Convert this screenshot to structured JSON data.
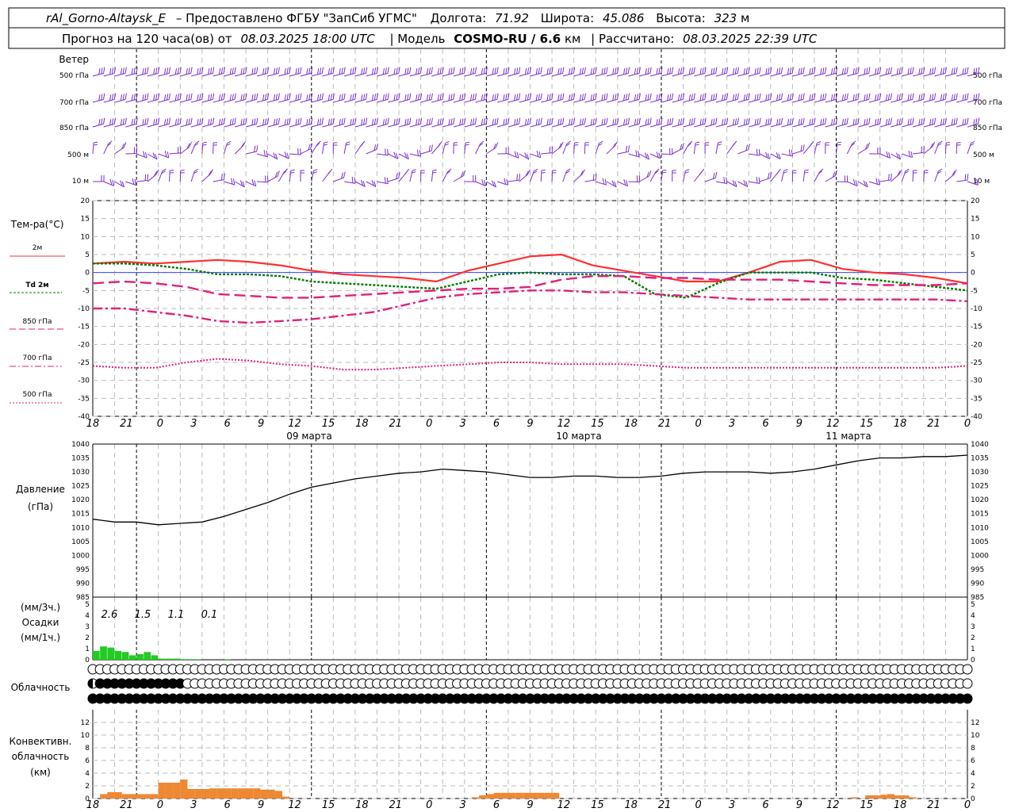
{
  "header": {
    "station": "rAl_Gorno-Altaysk_E",
    "provider": "– Предоставлено ФГБУ \"ЗапСиб УГМС\"",
    "lon_label": "Долгота:",
    "lon": "71.92",
    "lat_label": "Широта:",
    "lat": "45.086",
    "alt_label": "Высота:",
    "alt": "323",
    "alt_unit": "м",
    "fc_label": "Прогноз на 120 часа(ов)  от",
    "fc_time": "08.03.2025 18:00 UTC",
    "model_label": "| Модель",
    "model": "COSMO-RU / 6.6",
    "model_unit": "км",
    "calc_label": "| Рассчитано:",
    "calc_time": "08.03.2025 22:39 UTC"
  },
  "labels": {
    "wind": "Ветер",
    "wind_levels": [
      "500 гПа",
      "700 гПа",
      "850 гПа",
      "500 м",
      "10  м"
    ],
    "temp_title": "Тем-ра(°С)",
    "legend": [
      "2м",
      "Td  2м",
      "850 гПа",
      "700 гПа",
      "500 гПа"
    ],
    "pressure": "Давление",
    "pressure_unit": "(гПа)",
    "precip_unit3": "(мм/3ч.)",
    "precip": "Осадки",
    "precip_unit1": "(мм/1ч.)",
    "cloud": "Облачность",
    "conv": [
      "Конвективн.",
      "облачность",
      "(км)"
    ],
    "days": [
      "09 марта",
      "10 марта",
      "11 марта"
    ]
  },
  "time_ticks": [
    "18",
    "21",
    "0",
    "3",
    "6",
    "9",
    "12",
    "15",
    "18",
    "21",
    "0",
    "3",
    "6",
    "9",
    "12",
    "15",
    "18",
    "21",
    "0",
    "3",
    "6",
    "9",
    "12",
    "15",
    "18",
    "21",
    "0"
  ],
  "colors": {
    "wind": "#7b2fd0",
    "t2m": "#ff3030",
    "td2m": "#007a00",
    "t850": "#e0207a",
    "t700": "#e0207a",
    "t500": "#e0207a",
    "pressure": "#000000",
    "precip": "#22cc22",
    "conv": "#ee8833",
    "grid": "#bbbbbb",
    "zero": "#3344ff"
  },
  "chart_data": [
    {
      "type": "line",
      "name": "temperature",
      "ylabel": "Тем-ра(°С)",
      "ylim": [
        -40,
        20
      ],
      "yticks": [
        20,
        15,
        10,
        5,
        0,
        -5,
        -10,
        -15,
        -20,
        -25,
        -30,
        -35,
        -40
      ],
      "x_hours": [
        0,
        3,
        6,
        9,
        12,
        15,
        18,
        21,
        24,
        27,
        30,
        33,
        36,
        39,
        42,
        45,
        48,
        51,
        54,
        57,
        60,
        63,
        66,
        69,
        72,
        75,
        78
      ],
      "series": [
        {
          "name": "2м",
          "style": "solid",
          "values": [
            2.5,
            3,
            2.5,
            3,
            3.5,
            3,
            2,
            0.5,
            -0.5,
            -1,
            -1.5,
            -2.5,
            0.5,
            2.5,
            4.5,
            5,
            2,
            0.5,
            -1,
            -2.5,
            -2.5,
            0,
            3,
            3.5,
            1,
            0,
            -0.5,
            -1.5,
            -3
          ]
        },
        {
          "name": "Td  2м",
          "style": "dotted",
          "values": [
            2.5,
            2.5,
            2,
            1,
            -0.5,
            -0.5,
            -1,
            -2.5,
            -3,
            -3.5,
            -4,
            -4.5,
            -2.5,
            -0.5,
            0,
            -0.5,
            -0.5,
            -1,
            -6,
            -7,
            -3,
            0,
            0,
            0,
            -1.5,
            -2,
            -3,
            -4,
            -5
          ]
        },
        {
          "name": "850 гПа",
          "style": "dashed",
          "values": [
            -3,
            -2.5,
            -3,
            -4,
            -6,
            -6.5,
            -7,
            -7,
            -6.5,
            -6,
            -5.5,
            -5,
            -4.5,
            -4.5,
            -4,
            -2,
            -1,
            -1,
            -1.5,
            -1.5,
            -2,
            -2,
            -2,
            -2.5,
            -3,
            -3.5,
            -3.5,
            -3.5,
            -3
          ]
        },
        {
          "name": "700 гПа",
          "style": "dashdot",
          "values": [
            -10,
            -10,
            -11,
            -12,
            -13.5,
            -14,
            -13.5,
            -13,
            -12,
            -11,
            -9,
            -7,
            -6,
            -5.5,
            -5,
            -5,
            -5.5,
            -5.5,
            -6,
            -6.5,
            -7,
            -7.5,
            -7.5,
            -7.5,
            -7.5,
            -7.5,
            -7.5,
            -7.5,
            -8
          ]
        },
        {
          "name": "500 гПа",
          "style": "dotted",
          "values": [
            -26,
            -26.5,
            -26.5,
            -25,
            -24,
            -24.5,
            -25.5,
            -26,
            -27,
            -27,
            -26.5,
            -26,
            -25.5,
            -25,
            -25,
            -25.5,
            -25.5,
            -25.5,
            -26,
            -26.5,
            -26.5,
            -26.5,
            -26.5,
            -26.5,
            -26.5,
            -26.5,
            -26.5,
            -26.5,
            -26
          ]
        }
      ]
    },
    {
      "type": "line",
      "name": "pressure",
      "ylabel": "Давление (гПа)",
      "ylim": [
        985,
        1040
      ],
      "yticks": [
        1040,
        1035,
        1030,
        1025,
        1020,
        1015,
        1010,
        1005,
        1000,
        995,
        990,
        985
      ],
      "x_hours": [
        0,
        3,
        6,
        9,
        12,
        15,
        18,
        21,
        24,
        27,
        30,
        33,
        36,
        39,
        42,
        45,
        48,
        51,
        54,
        57,
        60,
        63,
        66,
        69,
        72,
        75,
        78,
        81,
        84,
        87,
        90,
        93,
        96,
        99,
        102,
        105,
        108,
        111,
        114,
        117,
        120
      ],
      "series": [
        {
          "name": "Давление",
          "values": [
            1013,
            1012,
            1012,
            1011,
            1011.5,
            1012,
            1014,
            1016.5,
            1019,
            1022,
            1024.5,
            1026,
            1027.5,
            1028.5,
            1029.5,
            1030,
            1031,
            1030.5,
            1030,
            1029,
            1028,
            1028,
            1028.5,
            1028.5,
            1028,
            1028,
            1028.5,
            1029.5,
            1030,
            1030,
            1030,
            1029.5,
            1030,
            1031,
            1032.5,
            1034,
            1035,
            1035,
            1035.5,
            1035.5,
            1036
          ]
        }
      ]
    },
    {
      "type": "bar",
      "name": "precipitation",
      "ylabel": "Осадки",
      "ylim": [
        0,
        5
      ],
      "yticks": [
        5,
        4,
        3,
        2,
        1,
        0
      ],
      "totals_3h": [
        "2.6",
        "1.5",
        "1.1",
        "0.1"
      ],
      "x_hours": [
        0,
        1,
        2,
        3,
        4,
        5,
        6,
        7,
        8,
        9,
        10,
        11,
        12,
        13,
        14,
        15,
        16,
        17,
        18
      ],
      "values": [
        0.8,
        1.2,
        1.1,
        0.8,
        0.7,
        0.4,
        0.5,
        0.7,
        0.4,
        0.1,
        0.1,
        0.1,
        0.05,
        0.05,
        0.05,
        0,
        0,
        0,
        0.05
      ]
    },
    {
      "type": "table",
      "name": "cloud_cover",
      "rows": [
        "high",
        "middle",
        "low"
      ],
      "note": "tenths cover per 3-hour step: 0=empty circle, 2=quarter, 5=half, 7=three-quarter, 10=filled",
      "high": [
        0,
        0,
        0,
        0,
        0,
        0,
        0,
        0,
        0,
        0,
        0,
        0,
        0,
        0,
        0,
        0,
        0,
        0,
        0,
        0,
        0,
        0,
        0,
        0,
        0,
        0,
        0,
        0,
        0,
        0,
        0,
        0,
        0,
        0,
        0,
        0,
        0,
        0,
        0,
        0,
        0,
        0,
        0,
        0,
        0,
        0,
        0,
        0,
        0,
        0,
        0,
        0,
        0,
        0,
        0,
        0,
        0,
        0,
        0,
        0,
        0,
        0,
        0,
        0,
        0,
        0,
        0,
        0,
        0,
        0,
        0,
        0,
        0,
        0,
        0,
        0,
        0,
        0,
        0,
        0,
        0,
        0,
        0,
        0,
        0,
        0,
        0,
        0,
        0,
        0,
        0,
        0,
        0,
        0,
        0,
        0,
        0,
        0,
        0,
        0,
        0,
        0,
        0,
        0,
        0,
        0,
        0,
        0,
        0,
        0,
        0,
        0,
        0,
        0,
        0,
        0,
        0,
        0,
        0,
        0,
        0
      ],
      "middle": [
        5,
        10,
        10,
        10,
        10,
        10,
        10,
        10,
        10,
        10,
        10,
        10,
        10,
        0,
        0,
        0,
        0,
        0,
        0,
        0,
        0,
        0,
        0,
        0,
        0,
        0,
        0,
        0,
        0,
        0,
        0,
        0,
        0,
        0,
        0,
        0,
        0,
        0,
        0,
        0,
        0,
        0,
        0,
        0,
        0,
        0,
        0,
        0,
        0,
        0,
        0,
        0,
        0,
        0,
        0,
        0,
        0,
        0,
        0,
        0,
        0,
        0,
        0,
        0,
        0,
        0,
        0,
        0,
        0,
        0,
        0,
        0,
        0,
        0,
        0,
        0,
        0,
        0,
        0,
        0,
        0,
        0,
        0,
        0,
        0,
        0,
        0,
        0,
        0,
        0,
        0,
        0,
        0,
        0,
        0,
        0,
        0,
        0,
        0,
        0,
        0,
        0,
        0,
        0,
        0,
        0,
        0,
        0,
        0,
        0,
        0,
        0,
        0,
        0,
        0,
        0,
        0,
        0,
        0,
        0,
        0
      ],
      "low": [
        10,
        10,
        10,
        10,
        10,
        10,
        10,
        10,
        10,
        10,
        10,
        10,
        10,
        10,
        10,
        10,
        10,
        10,
        10,
        10,
        10,
        10,
        10,
        10,
        10,
        10,
        10,
        10,
        10,
        10,
        10,
        10,
        10,
        10,
        10,
        10,
        10,
        10,
        10,
        10,
        10,
        10,
        10,
        10,
        10,
        10,
        10,
        10,
        10,
        10,
        10,
        10,
        10,
        10,
        10,
        10,
        10,
        10,
        10,
        10,
        10,
        10,
        10,
        10,
        10,
        10,
        10,
        10,
        10,
        10,
        10,
        10,
        10,
        10,
        10,
        10,
        10,
        10,
        10,
        10,
        10,
        10,
        10,
        10,
        10,
        10,
        10,
        10,
        10,
        10,
        10,
        10,
        10,
        10,
        10,
        10,
        10,
        10,
        10,
        10,
        10,
        10,
        10,
        10,
        10,
        10,
        10,
        10,
        10,
        10,
        10,
        10,
        10,
        10,
        10,
        10,
        10,
        10,
        10,
        10,
        10
      ]
    },
    {
      "type": "bar",
      "name": "convective_cloud",
      "ylabel": "Конвективн. облачность (км)",
      "ylim": [
        0,
        14
      ],
      "yticks": [
        12,
        10,
        8,
        6,
        4,
        2,
        0
      ],
      "x_hours": [
        0,
        1,
        2,
        3,
        4,
        5,
        6,
        7,
        8,
        9,
        10,
        11,
        12,
        13,
        14,
        15,
        16,
        17,
        18,
        19,
        20,
        21,
        22,
        23,
        24,
        25,
        26,
        27,
        28,
        29,
        30,
        31,
        32,
        33,
        34,
        35,
        36,
        37,
        38,
        39,
        40,
        41,
        42,
        43,
        44,
        45,
        46,
        47,
        48,
        49,
        50,
        51,
        52,
        53,
        54,
        55,
        56,
        57,
        58,
        59,
        60,
        61,
        62,
        63,
        64,
        65,
        66,
        67,
        68,
        69,
        70,
        71,
        72,
        73,
        74,
        75,
        76,
        77,
        78,
        79,
        80,
        81,
        82,
        83,
        84,
        85,
        86,
        87,
        88,
        89,
        90,
        91,
        92,
        93,
        94,
        95,
        96,
        97,
        98,
        99,
        100,
        101,
        102,
        103,
        104,
        105,
        106,
        107,
        108,
        109,
        110,
        111,
        112,
        113,
        114,
        115,
        116,
        117,
        118,
        119,
        120
      ],
      "values": [
        0,
        0.7,
        1,
        1,
        0.7,
        0.7,
        0.7,
        0.7,
        0.7,
        2.5,
        2.5,
        2.5,
        3,
        1.5,
        1.5,
        1.5,
        1.6,
        1.6,
        1.6,
        1.6,
        1.6,
        1.6,
        1.6,
        1.4,
        1.4,
        1.2,
        0.3,
        0,
        0,
        0,
        0,
        0,
        0,
        0,
        0,
        0,
        0,
        0,
        0,
        0,
        0,
        0,
        0,
        0,
        0,
        0,
        0,
        0,
        0,
        0,
        0,
        0,
        0.2,
        0.5,
        0.7,
        0.9,
        0.9,
        0.9,
        0.9,
        0.9,
        0.9,
        0.9,
        0.9,
        0.9,
        0,
        0,
        0,
        0,
        0,
        0,
        0,
        0,
        0,
        0,
        0,
        0,
        0,
        0,
        0,
        0,
        0,
        0,
        0,
        0,
        0,
        0,
        0,
        0,
        0,
        0,
        0,
        0,
        0,
        0,
        0,
        0,
        0,
        0,
        0,
        0,
        0,
        0,
        0,
        0,
        0.2,
        0,
        0.5,
        0.5,
        0.6,
        0.7,
        0.5,
        0.5,
        0.2,
        0,
        0,
        0,
        0,
        0,
        0,
        0,
        0,
        0
      ]
    }
  ]
}
